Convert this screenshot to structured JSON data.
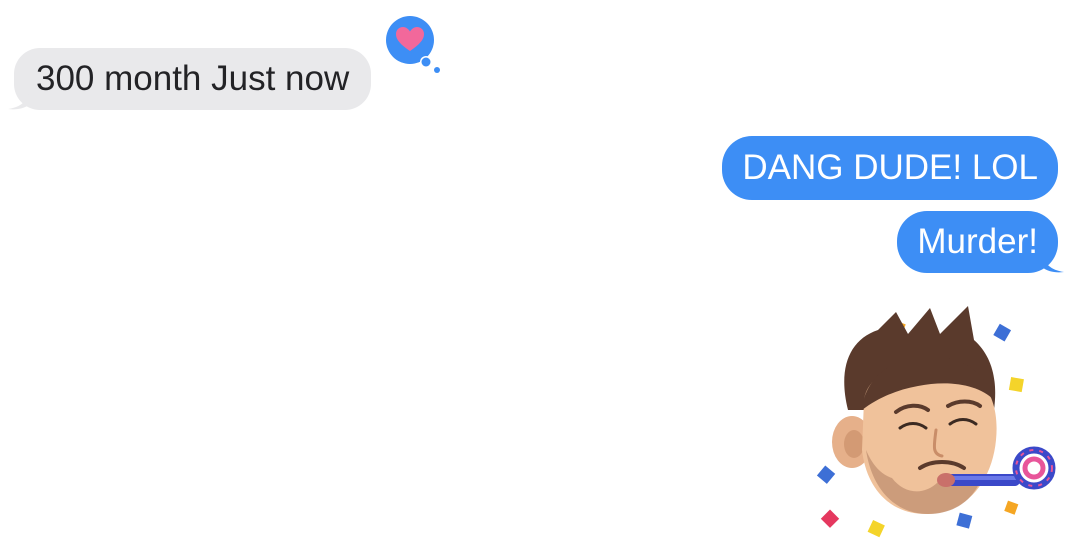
{
  "conversation": {
    "received": [
      {
        "text": "300 month Just now",
        "reaction": "heart"
      }
    ],
    "sent": [
      {
        "text": "DANG DUDE! LOL"
      },
      {
        "text": "Murder!"
      }
    ],
    "sticker": {
      "name": "party-memoji-sticker"
    }
  },
  "colors": {
    "sent_bubble": "#3d8ef5",
    "received_bubble": "#e9e9eb",
    "received_text": "#232326",
    "reaction_heart": "#f2689b"
  }
}
